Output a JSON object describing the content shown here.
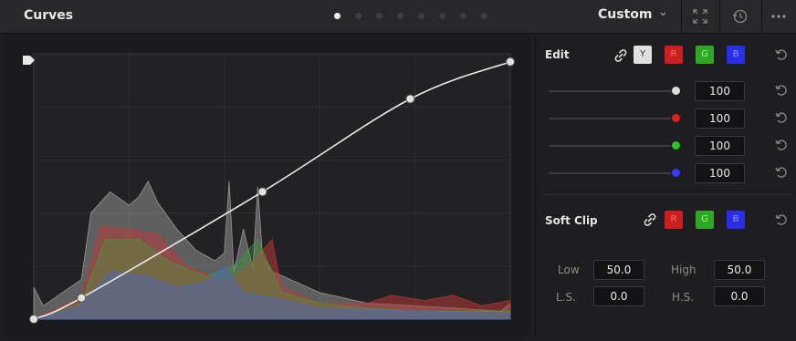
{
  "header": {
    "title": "Curves",
    "mode": "Custom",
    "pages": 8,
    "active_page": 0,
    "icons": [
      "chevron-down-icon",
      "fullscreen-icon",
      "reset-clock-icon",
      "more-options-icon"
    ]
  },
  "edit": {
    "label": "Edit",
    "channels": [
      {
        "id": "Y",
        "label": "Y",
        "bg": "#e0e0e0",
        "fg": "#333333"
      },
      {
        "id": "R",
        "label": "R",
        "bg": "#cc2020",
        "fg": "#ff6b6b"
      },
      {
        "id": "G",
        "label": "G",
        "bg": "#2fa826",
        "fg": "#9cf58c"
      },
      {
        "id": "B",
        "label": "B",
        "bg": "#2a2ee6",
        "fg": "#8c9cff"
      }
    ],
    "intensity": [
      {
        "channel": "Y",
        "value": "100",
        "color": "#dcdcdc"
      },
      {
        "channel": "R",
        "value": "100",
        "color": "#e01e1e"
      },
      {
        "channel": "G",
        "value": "100",
        "color": "#2ec21e"
      },
      {
        "channel": "B",
        "value": "100",
        "color": "#3a3aff"
      }
    ]
  },
  "soft_clip": {
    "label": "Soft Clip",
    "channels": [
      {
        "id": "R",
        "label": "R",
        "bg": "#cc2020",
        "fg": "#ff6b6b"
      },
      {
        "id": "G",
        "label": "G",
        "bg": "#2fa826",
        "fg": "#9cf58c"
      },
      {
        "id": "B",
        "label": "B",
        "bg": "#2a2ee6",
        "fg": "#8c9cff"
      }
    ],
    "low_label": "Low",
    "low_value": "50.0",
    "high_label": "High",
    "high_value": "50.0",
    "ls_label": "L.S.",
    "ls_value": "0.0",
    "hs_label": "H.S.",
    "hs_value": "0.0"
  },
  "curve": {
    "control_points": [
      [
        0,
        0
      ],
      [
        0.1,
        0.08
      ],
      [
        0.48,
        0.48
      ],
      [
        0.79,
        0.83
      ],
      [
        1.0,
        0.97
      ]
    ],
    "histogram_colors": {
      "luma": "#aaaaaa",
      "red": "#c03a36",
      "green": "#3fa23a",
      "blue": "#4c64d8"
    }
  }
}
